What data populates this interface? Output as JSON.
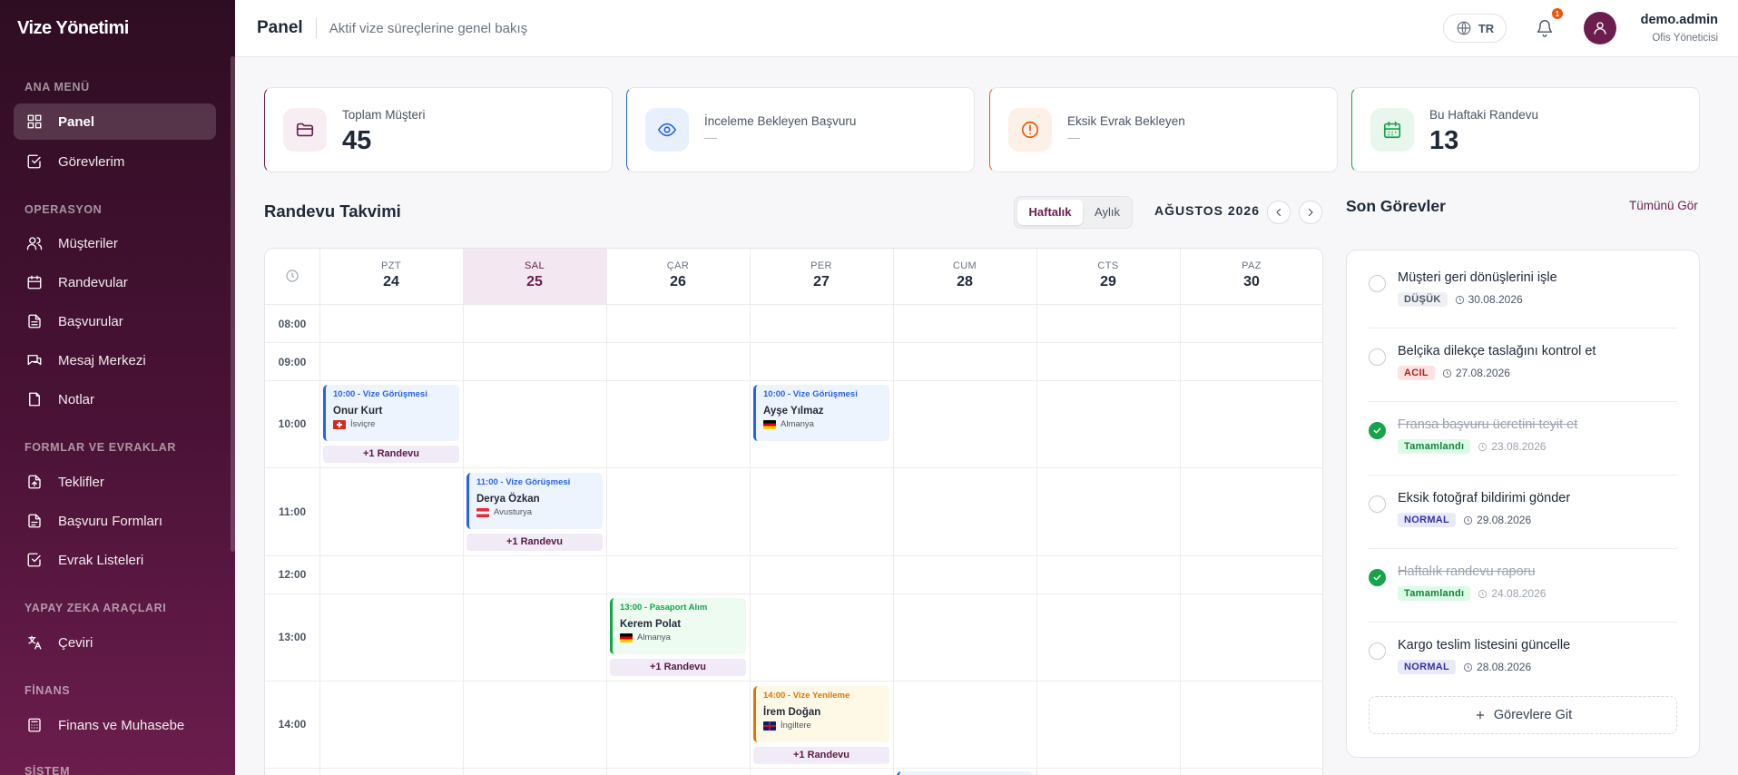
{
  "app": {
    "brand": "Vize Yönetimi"
  },
  "sidebar": {
    "sections": [
      {
        "title": "ANA MENÜ"
      },
      {
        "title": "OPERASYON"
      },
      {
        "title": "FORMLAR VE EVRAKLAR"
      },
      {
        "title": "YAPAY ZEKA ARAÇLARI"
      },
      {
        "title": "FİNANS"
      },
      {
        "title": "SİSTEM"
      }
    ],
    "items": [
      {
        "label": "Panel",
        "icon": "grid-icon",
        "active": true
      },
      {
        "label": "Görevlerim",
        "icon": "check-square-icon"
      },
      {
        "label": "Müşteriler",
        "icon": "users-icon"
      },
      {
        "label": "Randevular",
        "icon": "calendar-icon"
      },
      {
        "label": "Başvurular",
        "icon": "file-text-icon"
      },
      {
        "label": "Mesaj Merkezi",
        "icon": "messages-icon"
      },
      {
        "label": "Notlar",
        "icon": "note-icon"
      },
      {
        "label": "Teklifler",
        "icon": "file-export-icon"
      },
      {
        "label": "Başvuru Formları",
        "icon": "form-icon"
      },
      {
        "label": "Evrak Listeleri",
        "icon": "checklist-icon"
      },
      {
        "label": "Çeviri",
        "icon": "translate-icon"
      },
      {
        "label": "Finans ve Muhasebe",
        "icon": "calculator-icon"
      }
    ]
  },
  "header": {
    "title": "Panel",
    "subtitle": "Aktif vize süreçlerine genel bakış",
    "lang": "TR",
    "notif_count": "1",
    "user_name": "demo.admin",
    "user_role": "Ofis Yöneticisi"
  },
  "stats": [
    {
      "label": "Toplam Müşteri",
      "value": "45",
      "icon": "folder-icon",
      "accent": "#6b1d4d"
    },
    {
      "label": "İnceleme Bekleyen Başvuru",
      "value": "—",
      "icon": "eye-icon",
      "accent": "#2563eb"
    },
    {
      "label": "Eksik Evrak Bekleyen",
      "value": "—",
      "icon": "alert-circle-icon",
      "accent": "#ea580c"
    },
    {
      "label": "Bu Haftaki Randevu",
      "value": "13",
      "icon": "calendar-icon",
      "accent": "#16a34a"
    }
  ],
  "calendar": {
    "title": "Randevu Takvimi",
    "view_weekly": "Haftalık",
    "view_monthly": "Aylık",
    "month": "AĞUSTOS 2026",
    "days": [
      {
        "name": "PZT",
        "date": "24"
      },
      {
        "name": "SAL",
        "date": "25",
        "today": true
      },
      {
        "name": "ÇAR",
        "date": "26"
      },
      {
        "name": "PER",
        "date": "27"
      },
      {
        "name": "CUM",
        "date": "28"
      },
      {
        "name": "CTS",
        "date": "29"
      },
      {
        "name": "PAZ",
        "date": "30"
      }
    ],
    "times": [
      "08:00",
      "09:00",
      "10:00",
      "11:00",
      "12:00",
      "13:00",
      "14:00"
    ],
    "more_label": "+1 Randevu",
    "events": [
      {
        "time_type": "10:00 - Vize Görüşmesi",
        "name": "Onur Kurt",
        "country": "İsviçre",
        "flag": "ch",
        "color": "#2563eb"
      },
      {
        "time_type": "11:00 - Vize Görüşmesi",
        "name": "Derya Özkan",
        "country": "Avusturya",
        "flag": "at",
        "color": "#2563eb"
      },
      {
        "time_type": "13:00 - Pasaport Alım",
        "name": "Kerem Polat",
        "country": "Almanya",
        "flag": "de",
        "color": "#16a34a"
      },
      {
        "time_type": "10:00 - Vize Görüşmesi",
        "name": "Ayşe Yılmaz",
        "country": "Almanya",
        "flag": "de",
        "color": "#2563eb"
      },
      {
        "time_type": "14:00 - Vize Yenileme",
        "name": "İrem Doğan",
        "country": "İngiltere",
        "flag": "gb",
        "color": "#d97706"
      }
    ]
  },
  "tasks": {
    "title": "Son Görevler",
    "view_all": "Tümünü Gör",
    "items": [
      {
        "title": "Müşteri geri dönüşlerini işle",
        "tag": "DÜŞÜK",
        "date": "30.08.2026",
        "done": false
      },
      {
        "title": "Belçika dilekçe taslağını kontrol et",
        "tag": "ACIL",
        "date": "27.08.2026",
        "done": false
      },
      {
        "title": "Fransa başvuru ücretini teyit et",
        "tag": "Tamamlandı",
        "date": "23.08.2026",
        "done": true
      },
      {
        "title": "Eksik fotoğraf bildirimi gönder",
        "tag": "NORMAL",
        "date": "29.08.2026",
        "done": false
      },
      {
        "title": "Haftalık randevu raporu",
        "tag": "Tamamlandı",
        "date": "24.08.2026",
        "done": true
      },
      {
        "title": "Kargo teslim listesini güncelle",
        "tag": "NORMAL",
        "date": "28.08.2026",
        "done": false
      }
    ],
    "goto_label": "Görevlere Git"
  }
}
